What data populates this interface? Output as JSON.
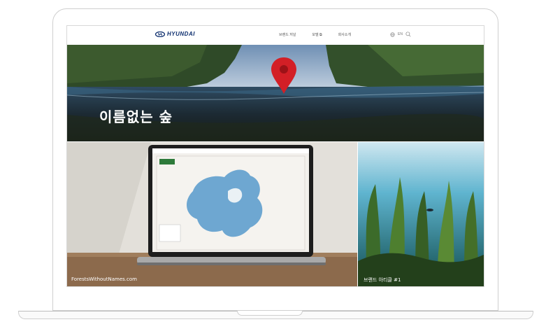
{
  "nav": {
    "brand": "HYUNDAI",
    "links": [
      "브랜드 저널",
      "모델",
      "회사소개"
    ],
    "lang": "EN"
  },
  "hero": {
    "title": "이름없는 숲"
  },
  "cards": [
    {
      "caption": "ForestsWithoutNames.com"
    },
    {
      "caption": "브랜드 아티클 #1"
    }
  ],
  "colors": {
    "brand": "#0d2e6e",
    "pin": "#d31f26"
  }
}
